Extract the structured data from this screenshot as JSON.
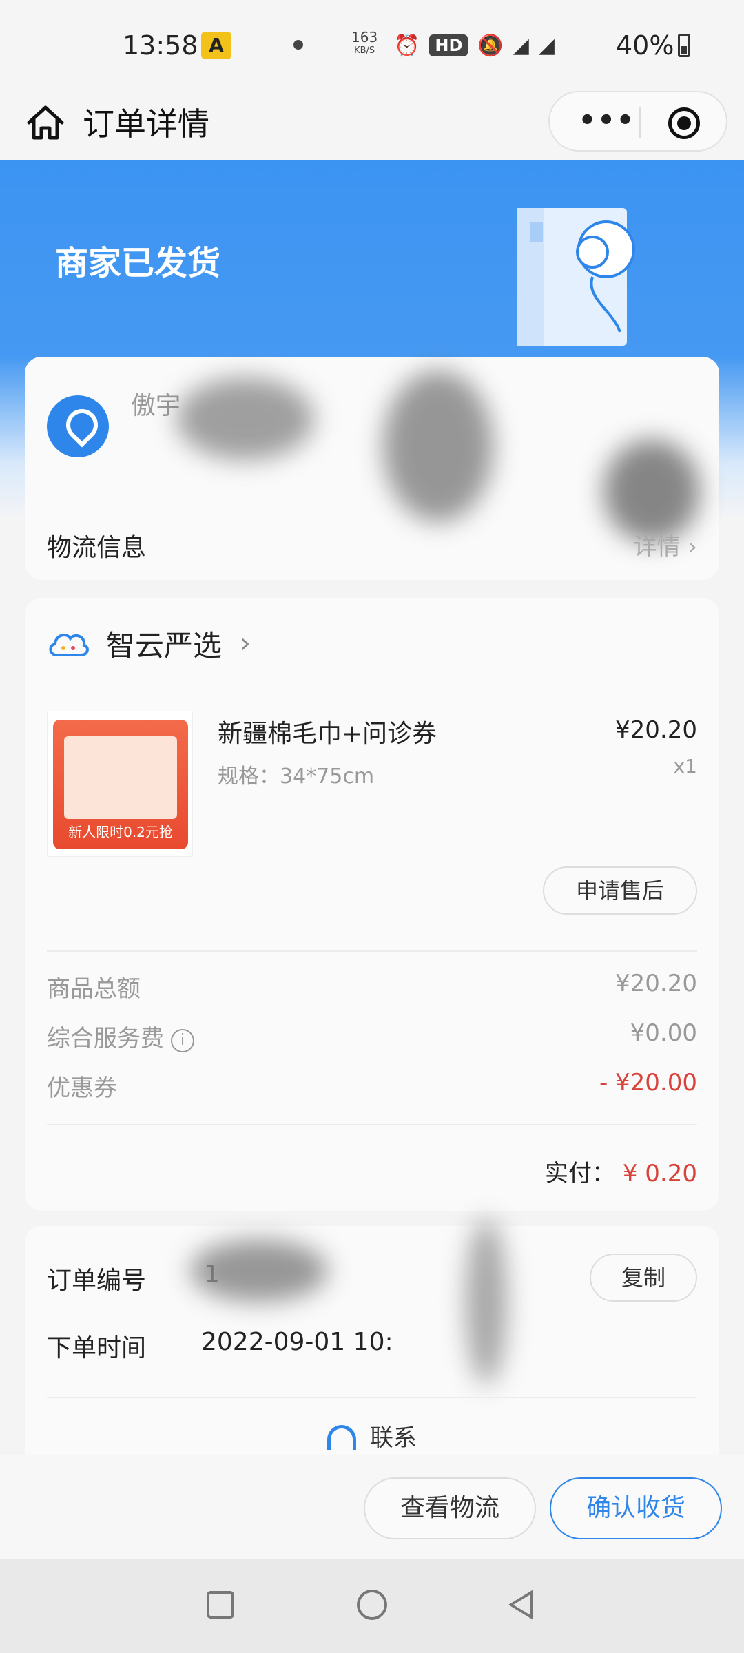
{
  "status_bar": {
    "time": "13:58",
    "app_icon": "A",
    "network_rate": "163",
    "network_unit": "KB/S",
    "hd_badge": "HD",
    "battery": "40%"
  },
  "header": {
    "title": "订单详情"
  },
  "banner": {
    "status": "商家已发货"
  },
  "address": {
    "name": "傲宇",
    "logistics_label": "物流信息",
    "logistics_detail": "详情"
  },
  "shop": {
    "name": "智云严选"
  },
  "product": {
    "title": "新疆棉毛巾+问诊券",
    "spec": "规格：34*75cm",
    "price": "¥20.20",
    "qty": "x1",
    "image_caption": "新人限时0.2元抢",
    "aftersale_label": "申请售后"
  },
  "fees": [
    {
      "label": "商品总额",
      "value": "¥20.20"
    },
    {
      "label": "综合服务费",
      "value": "¥0.00"
    },
    {
      "label": "优惠券",
      "value": "- ¥20.00"
    }
  ],
  "paid": {
    "label": "实付：",
    "value": "¥ 0.20"
  },
  "order_info": {
    "number_label": "订单编号",
    "number_value": "1",
    "copy_label": "复制",
    "time_label": "下单时间",
    "time_value": "2022-09-01 10:",
    "contact_label": "联系"
  },
  "actions": {
    "logistics": "查看物流",
    "confirm": "确认收货"
  },
  "colors": {
    "brand_blue": "#3c94f2",
    "discount_red": "#d9423a"
  }
}
